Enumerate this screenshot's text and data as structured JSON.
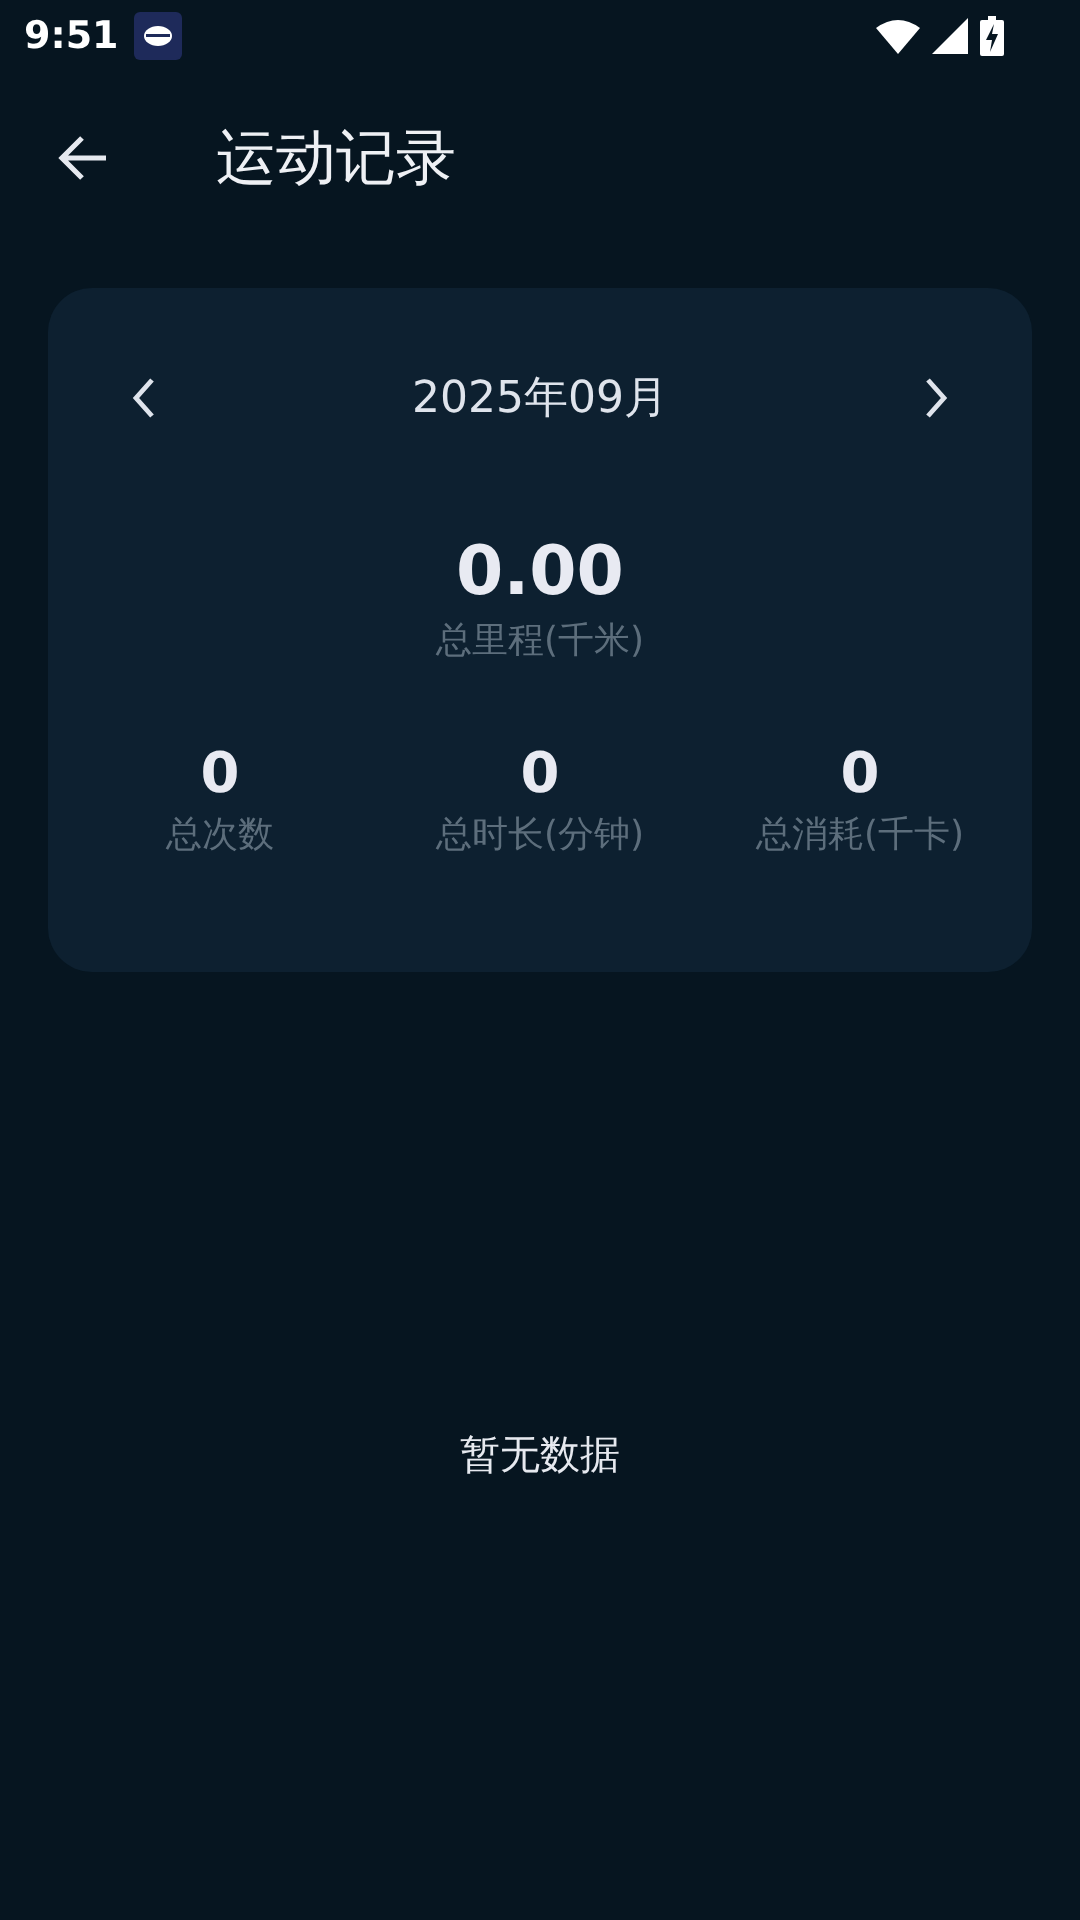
{
  "status_bar": {
    "time": "9:51"
  },
  "header": {
    "title": "运动记录"
  },
  "summary": {
    "month": "2025年09月",
    "distance": {
      "value": "0.00",
      "label": "总里程(千米)"
    },
    "stats": [
      {
        "value": "0",
        "label": "总次数"
      },
      {
        "value": "0",
        "label": "总时长(分钟)"
      },
      {
        "value": "0",
        "label": "总消耗(千卡)"
      }
    ]
  },
  "empty_message": "暂无数据"
}
